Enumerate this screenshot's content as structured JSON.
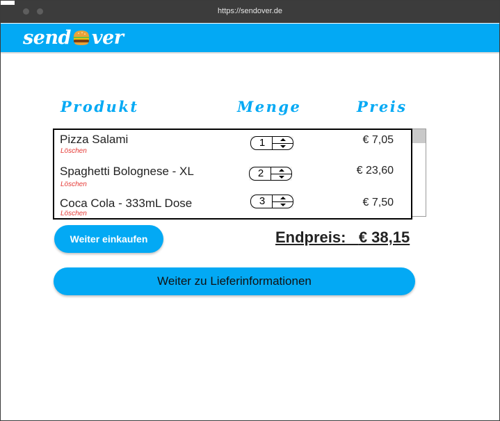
{
  "browser": {
    "url": "https://sendover.de"
  },
  "brand": {
    "name_left": "send",
    "name_right": "ver",
    "logo_icon": "burger-icon",
    "color": "#03a9f4"
  },
  "cart": {
    "headers": {
      "product": "Produkt",
      "quantity": "Menge",
      "price": "Preis"
    },
    "items": [
      {
        "name": "Pizza Salami",
        "remove_label": "Löschen",
        "quantity": "1",
        "price": "€ 7,05"
      },
      {
        "name": "Spaghetti Bolognese - XL",
        "remove_label": "Löschen",
        "quantity": "2",
        "price": "€ 23,60"
      },
      {
        "name": "Coca Cola - 333mL Dose",
        "remove_label": "Löschen",
        "quantity": "3",
        "price": "€ 7,50"
      }
    ],
    "total_label": "Endpreis:",
    "total_value": "€ 38,15"
  },
  "actions": {
    "continue_shopping": "Weiter einkaufen",
    "continue_delivery": "Weiter zu Lieferinformationen"
  }
}
